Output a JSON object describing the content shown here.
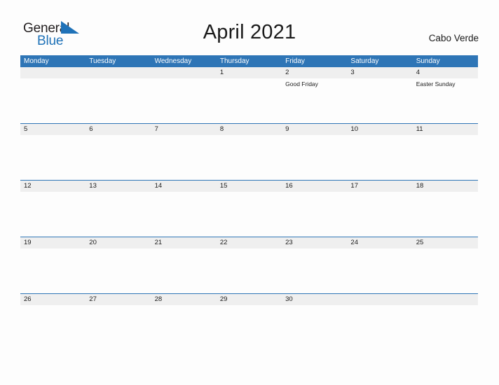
{
  "brand": {
    "name_part1": "General",
    "name_part2": "Blue",
    "flag_color": "#1F72B8",
    "text_color": "#231F20"
  },
  "header": {
    "title": "April 2021",
    "country": "Cabo Verde"
  },
  "theme": {
    "header_blue": "#2E75B6",
    "band_gray": "#EFEFEF",
    "page_background": "#FDFDFD",
    "text": "#1A1A1A"
  },
  "calendar": {
    "weekday_headers": [
      "Monday",
      "Tuesday",
      "Wednesday",
      "Thursday",
      "Friday",
      "Saturday",
      "Sunday"
    ],
    "weeks": [
      [
        {
          "day": "",
          "event": ""
        },
        {
          "day": "",
          "event": ""
        },
        {
          "day": "",
          "event": ""
        },
        {
          "day": "1",
          "event": ""
        },
        {
          "day": "2",
          "event": "Good Friday"
        },
        {
          "day": "3",
          "event": ""
        },
        {
          "day": "4",
          "event": "Easter Sunday"
        }
      ],
      [
        {
          "day": "5",
          "event": ""
        },
        {
          "day": "6",
          "event": ""
        },
        {
          "day": "7",
          "event": ""
        },
        {
          "day": "8",
          "event": ""
        },
        {
          "day": "9",
          "event": ""
        },
        {
          "day": "10",
          "event": ""
        },
        {
          "day": "11",
          "event": ""
        }
      ],
      [
        {
          "day": "12",
          "event": ""
        },
        {
          "day": "13",
          "event": ""
        },
        {
          "day": "14",
          "event": ""
        },
        {
          "day": "15",
          "event": ""
        },
        {
          "day": "16",
          "event": ""
        },
        {
          "day": "17",
          "event": ""
        },
        {
          "day": "18",
          "event": ""
        }
      ],
      [
        {
          "day": "19",
          "event": ""
        },
        {
          "day": "20",
          "event": ""
        },
        {
          "day": "21",
          "event": ""
        },
        {
          "day": "22",
          "event": ""
        },
        {
          "day": "23",
          "event": ""
        },
        {
          "day": "24",
          "event": ""
        },
        {
          "day": "25",
          "event": ""
        }
      ],
      [
        {
          "day": "26",
          "event": ""
        },
        {
          "day": "27",
          "event": ""
        },
        {
          "day": "28",
          "event": ""
        },
        {
          "day": "29",
          "event": ""
        },
        {
          "day": "30",
          "event": ""
        },
        {
          "day": "",
          "event": ""
        },
        {
          "day": "",
          "event": ""
        }
      ]
    ]
  }
}
